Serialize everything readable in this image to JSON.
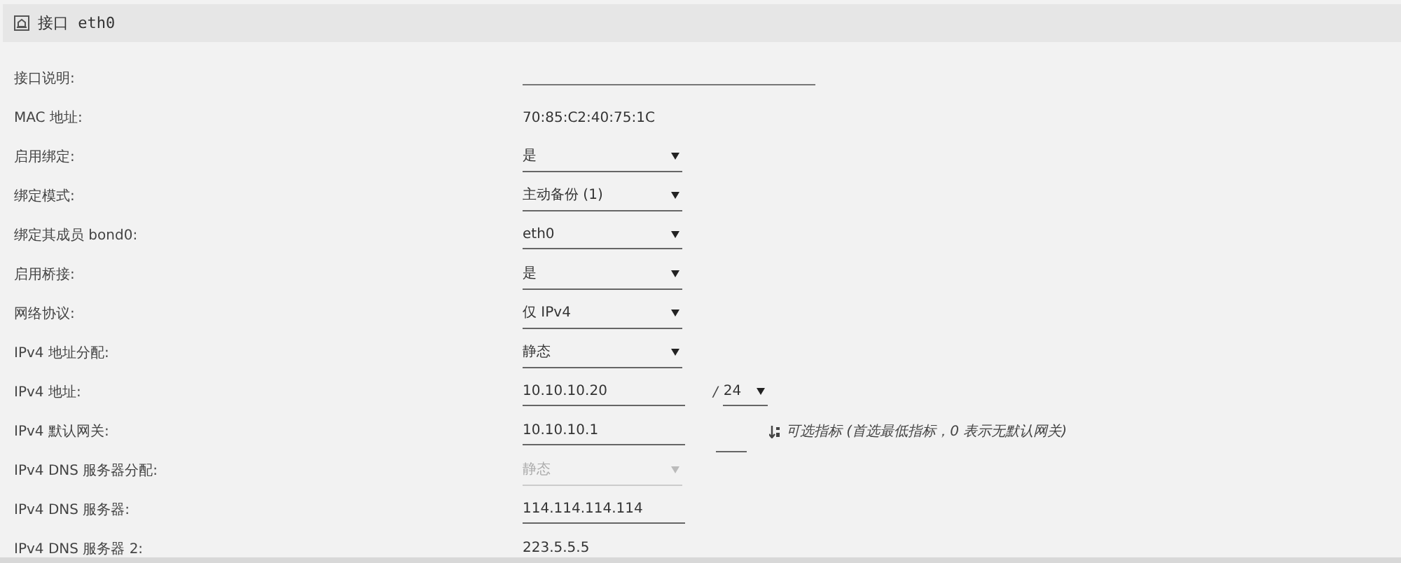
{
  "section": {
    "title": "接口 eth0"
  },
  "rows": [
    {
      "label": "接口说明:",
      "kind": "long-field"
    },
    {
      "label": "MAC 地址:",
      "kind": "static",
      "value": "70:85:C2:40:75:1C"
    },
    {
      "label": "启用绑定:",
      "kind": "select",
      "value": "是",
      "disabled": false
    },
    {
      "label": "绑定模式:",
      "kind": "select",
      "value": "主动备份 (1)",
      "disabled": false
    },
    {
      "label": "绑定其成员 bond0:",
      "kind": "select",
      "value": "eth0",
      "disabled": false
    },
    {
      "label": "启用桥接:",
      "kind": "select",
      "value": "是",
      "disabled": false
    },
    {
      "label": "网络协议:",
      "kind": "select",
      "value": "仅 IPv4",
      "disabled": false
    },
    {
      "label": "IPv4 地址分配:",
      "kind": "select",
      "value": "静态",
      "disabled": false
    },
    {
      "label": "IPv4 地址:",
      "kind": "field",
      "value": "10.10.10.20",
      "prefix": {
        "separator": "/",
        "value": "24"
      }
    },
    {
      "label": "IPv4 默认网关:",
      "kind": "field",
      "value": "10.10.10.1",
      "metric": {
        "hint": "可选指标 (首选最低指标，0 表示无默认网关)"
      }
    },
    {
      "label": "IPv4 DNS 服务器分配:",
      "kind": "select",
      "value": "静态",
      "disabled": true
    },
    {
      "label": "IPv4 DNS 服务器:",
      "kind": "field",
      "value": "114.114.114.114"
    },
    {
      "label": "IPv4 DNS 服务器 2:",
      "kind": "field",
      "value": "223.5.5.5"
    }
  ]
}
